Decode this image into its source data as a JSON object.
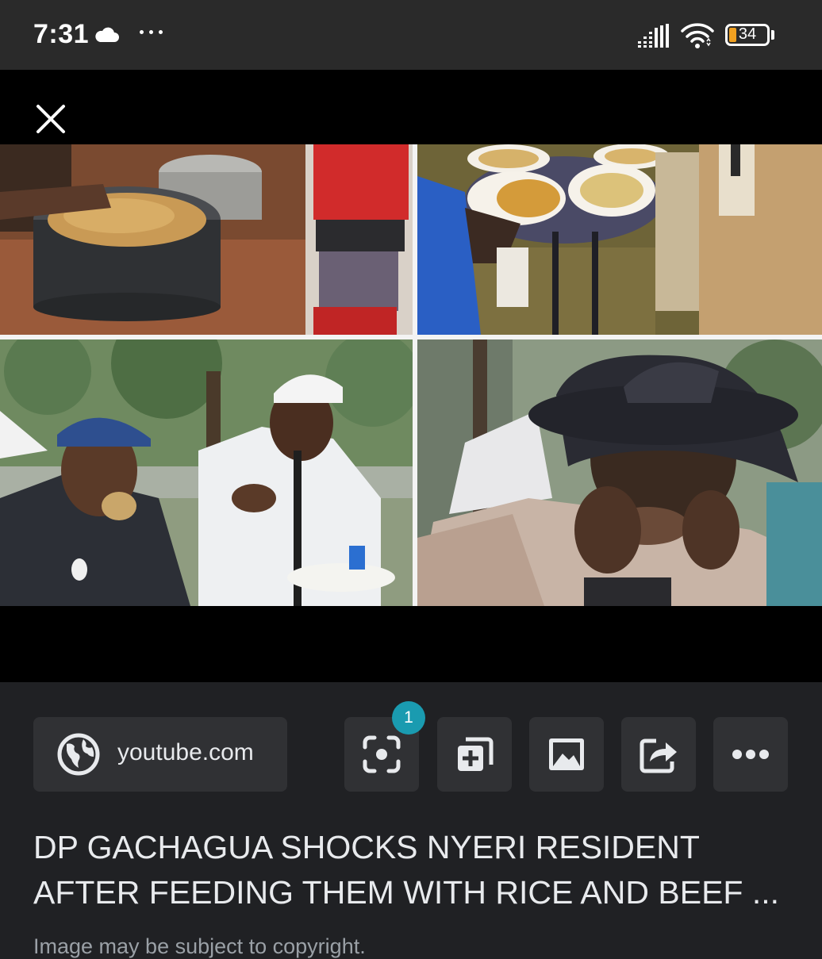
{
  "status_bar": {
    "time": "7:31",
    "battery": "34",
    "icons": [
      "cloud-icon",
      "more-notifications-icon",
      "signal-icon",
      "wifi-icon",
      "battery-icon"
    ]
  },
  "viewer": {
    "close_icon": "close-icon",
    "image_description_icons": [
      "photo-cooking-pot",
      "photo-plates-table",
      "photo-men-eating",
      "photo-elder-eating"
    ]
  },
  "source": {
    "label": "youtube.com",
    "icon": "globe-icon"
  },
  "actions": {
    "lens_badge": "1",
    "buttons": [
      "lens-icon",
      "add-to-collection-icon",
      "image-icon",
      "share-icon",
      "more-icon"
    ]
  },
  "title": "DP GACHAGUA SHOCKS NYERI RESIDENT AFTER FEEDING THEM WITH RICE AND BEEF ...",
  "copyright": "Image may be subject to copyright.",
  "colors": {
    "background": "#202124",
    "chip": "#303134",
    "badge": "#1a9bb0",
    "battery_fill": "#f0a020"
  }
}
